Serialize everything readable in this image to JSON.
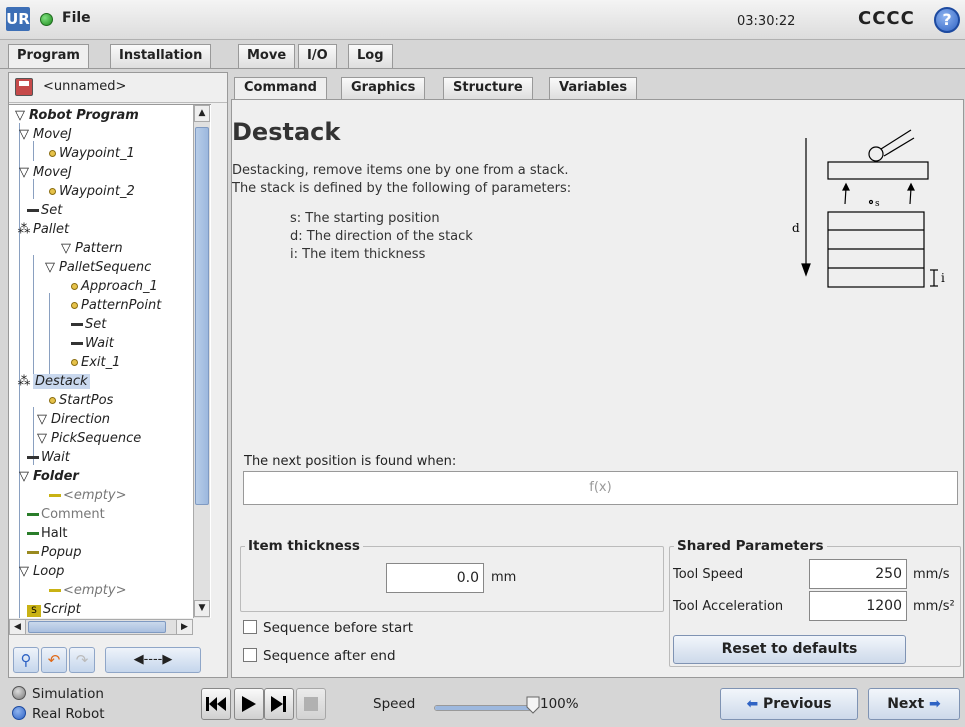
{
  "titlebar": {
    "logo": "UR",
    "file_menu": "File",
    "clock": "03:30:22",
    "robot_name": "CCCC",
    "help": "?"
  },
  "top_tabs": [
    "Program",
    "Installation",
    "Move",
    "I/O",
    "Log"
  ],
  "left": {
    "program_name": "<unnamed>",
    "tree": [
      {
        "label": "Robot Program",
        "glyph": "▽"
      },
      {
        "label": "MoveJ",
        "glyph": "▽"
      },
      {
        "label": "Waypoint_1"
      },
      {
        "label": "MoveJ",
        "glyph": "▽"
      },
      {
        "label": "Waypoint_2"
      },
      {
        "label": "Set"
      },
      {
        "label": "Pallet",
        "glyph": "⁂"
      },
      {
        "label": "Pattern",
        "glyph": "▽"
      },
      {
        "label": "PalletSequenc",
        "glyph": "▽"
      },
      {
        "label": "Approach_1"
      },
      {
        "label": "PatternPoint"
      },
      {
        "label": "Set"
      },
      {
        "label": "Wait"
      },
      {
        "label": "Exit_1"
      },
      {
        "label": "Destack",
        "glyph": "⁂"
      },
      {
        "label": "StartPos"
      },
      {
        "label": "Direction",
        "glyph": "▽"
      },
      {
        "label": "PickSequence",
        "glyph": "▽"
      },
      {
        "label": "Wait"
      },
      {
        "label": "Folder",
        "glyph": "▽"
      },
      {
        "label": "<empty>"
      },
      {
        "label": "Comment"
      },
      {
        "label": "Halt"
      },
      {
        "label": "Popup"
      },
      {
        "label": "Loop",
        "glyph": "▽"
      },
      {
        "label": "<empty>"
      },
      {
        "label": "Script"
      }
    ],
    "tools": {
      "move_arrows": "◀----▶"
    }
  },
  "sub_tabs": [
    "Command",
    "Graphics",
    "Structure",
    "Variables"
  ],
  "command": {
    "title": "Destack",
    "desc_line1": "Destacking, remove items one by one from a stack.",
    "desc_line2": "The stack is defined by the following of parameters:",
    "param_s": "s: The starting position",
    "param_d": "d: The direction of the stack",
    "param_i": "i: The item thickness",
    "diagram_labels": {
      "d": "d",
      "s": "s",
      "i": "i"
    },
    "next_position_label": "The next position is found when:",
    "fx_placeholder": "f(x)",
    "item_thickness": {
      "title": "Item thickness",
      "value": "0.0",
      "unit": "mm"
    },
    "shared": {
      "title": "Shared Parameters",
      "tool_speed_label": "Tool Speed",
      "tool_speed_value": "250",
      "tool_speed_unit": "mm/s",
      "tool_accel_label": "Tool Acceleration",
      "tool_accel_value": "1200",
      "tool_accel_unit": "mm/s²",
      "reset_label": "Reset to defaults"
    },
    "seq_before": "Sequence before start",
    "seq_after": "Sequence after end"
  },
  "bottom": {
    "simulation": "Simulation",
    "real_robot": "Real Robot",
    "speed_label": "Speed",
    "speed_value": "100%",
    "speed_fraction": 1.0,
    "previous": "Previous",
    "next": "Next"
  },
  "colors": {
    "accent": "#3d6fb6",
    "selected": "#c9d8ee",
    "running": "#1c8a1c"
  }
}
